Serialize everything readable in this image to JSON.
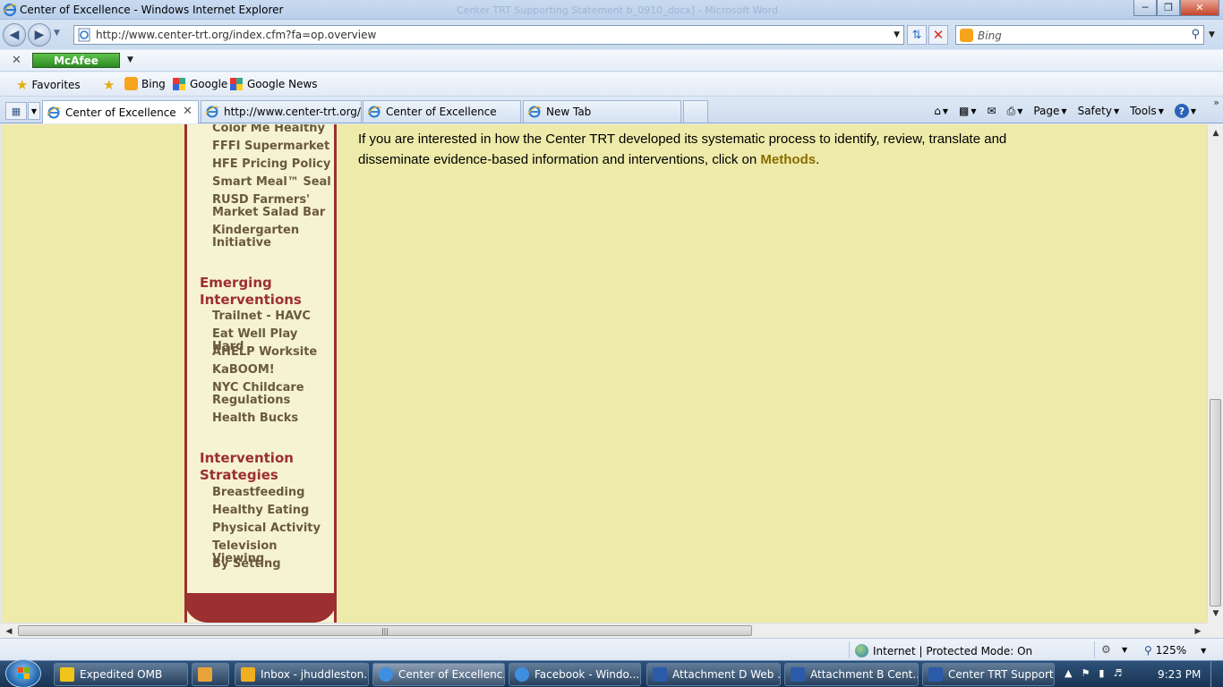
{
  "window": {
    "title": "Center of Excellence - Windows Internet Explorer",
    "ghost_title": "Center TRT Supporting Statement b_0910_docx] - Microsoft Word"
  },
  "address": {
    "url": "http://www.center-trt.org/index.cfm?fa=op.overview",
    "search_placeholder": "Bing"
  },
  "toolbar": {
    "mcafee_label": "McAfee"
  },
  "favorites": {
    "label": "Favorites",
    "items": [
      {
        "label": "Bing",
        "icon": "bing-icon"
      },
      {
        "label": "Google",
        "icon": "google-icon"
      },
      {
        "label": "Google News",
        "icon": "google-icon"
      }
    ]
  },
  "tabs": [
    {
      "label": "Center of Excellence",
      "active": true
    },
    {
      "label": "http://www.center-trt.org/...",
      "active": false
    },
    {
      "label": "Center of Excellence",
      "active": false
    },
    {
      "label": "New Tab",
      "active": false
    }
  ],
  "commandbar": {
    "page": "Page",
    "safety": "Safety",
    "tools": "Tools"
  },
  "sidebar": {
    "links_top": [
      "Color Me Healthy",
      "FFFI Supermarket",
      "HFE Pricing Policy",
      "Smart Meal™ Seal",
      "RUSD Farmers' Market Salad Bar",
      "Kindergarten Initiative"
    ],
    "heading_emerging": "Emerging Interventions",
    "links_emerging": [
      "Trailnet - HAVC",
      "Eat Well Play Hard",
      "AHELP Worksite",
      "KaBOOM!",
      "NYC Childcare Regulations",
      "Health Bucks"
    ],
    "heading_strategies": "Intervention Strategies",
    "links_strategies": [
      "Breastfeeding",
      "Healthy Eating",
      "Physical Activity",
      "Television Viewing",
      "By Setting"
    ]
  },
  "main": {
    "text_before": "If you are interested in how the Center TRT developed its systematic process to identify, review, translate and disseminate evidence-based information and interventions, click on ",
    "link": "Methods",
    "text_after": "."
  },
  "statusbar": {
    "zone": "Internet | Protected Mode: On",
    "zoom": "125%"
  },
  "taskbar": {
    "items": [
      {
        "label": "Expedited OMB",
        "color": "#f0c419"
      },
      {
        "label": "",
        "color": "#e8a33a"
      },
      {
        "label": "Inbox - jhuddleston...",
        "color": "#f0b020"
      },
      {
        "label": "Center of Excellenc...",
        "color": "#3f8fe0"
      },
      {
        "label": "Facebook - Windo...",
        "color": "#3f8fe0"
      },
      {
        "label": "Attachment D Web ...",
        "color": "#2b5aa8"
      },
      {
        "label": "Attachment B Cent...",
        "color": "#2b5aa8"
      },
      {
        "label": "Center TRT Support...",
        "color": "#2b5aa8"
      }
    ],
    "time": "9:23 PM"
  }
}
